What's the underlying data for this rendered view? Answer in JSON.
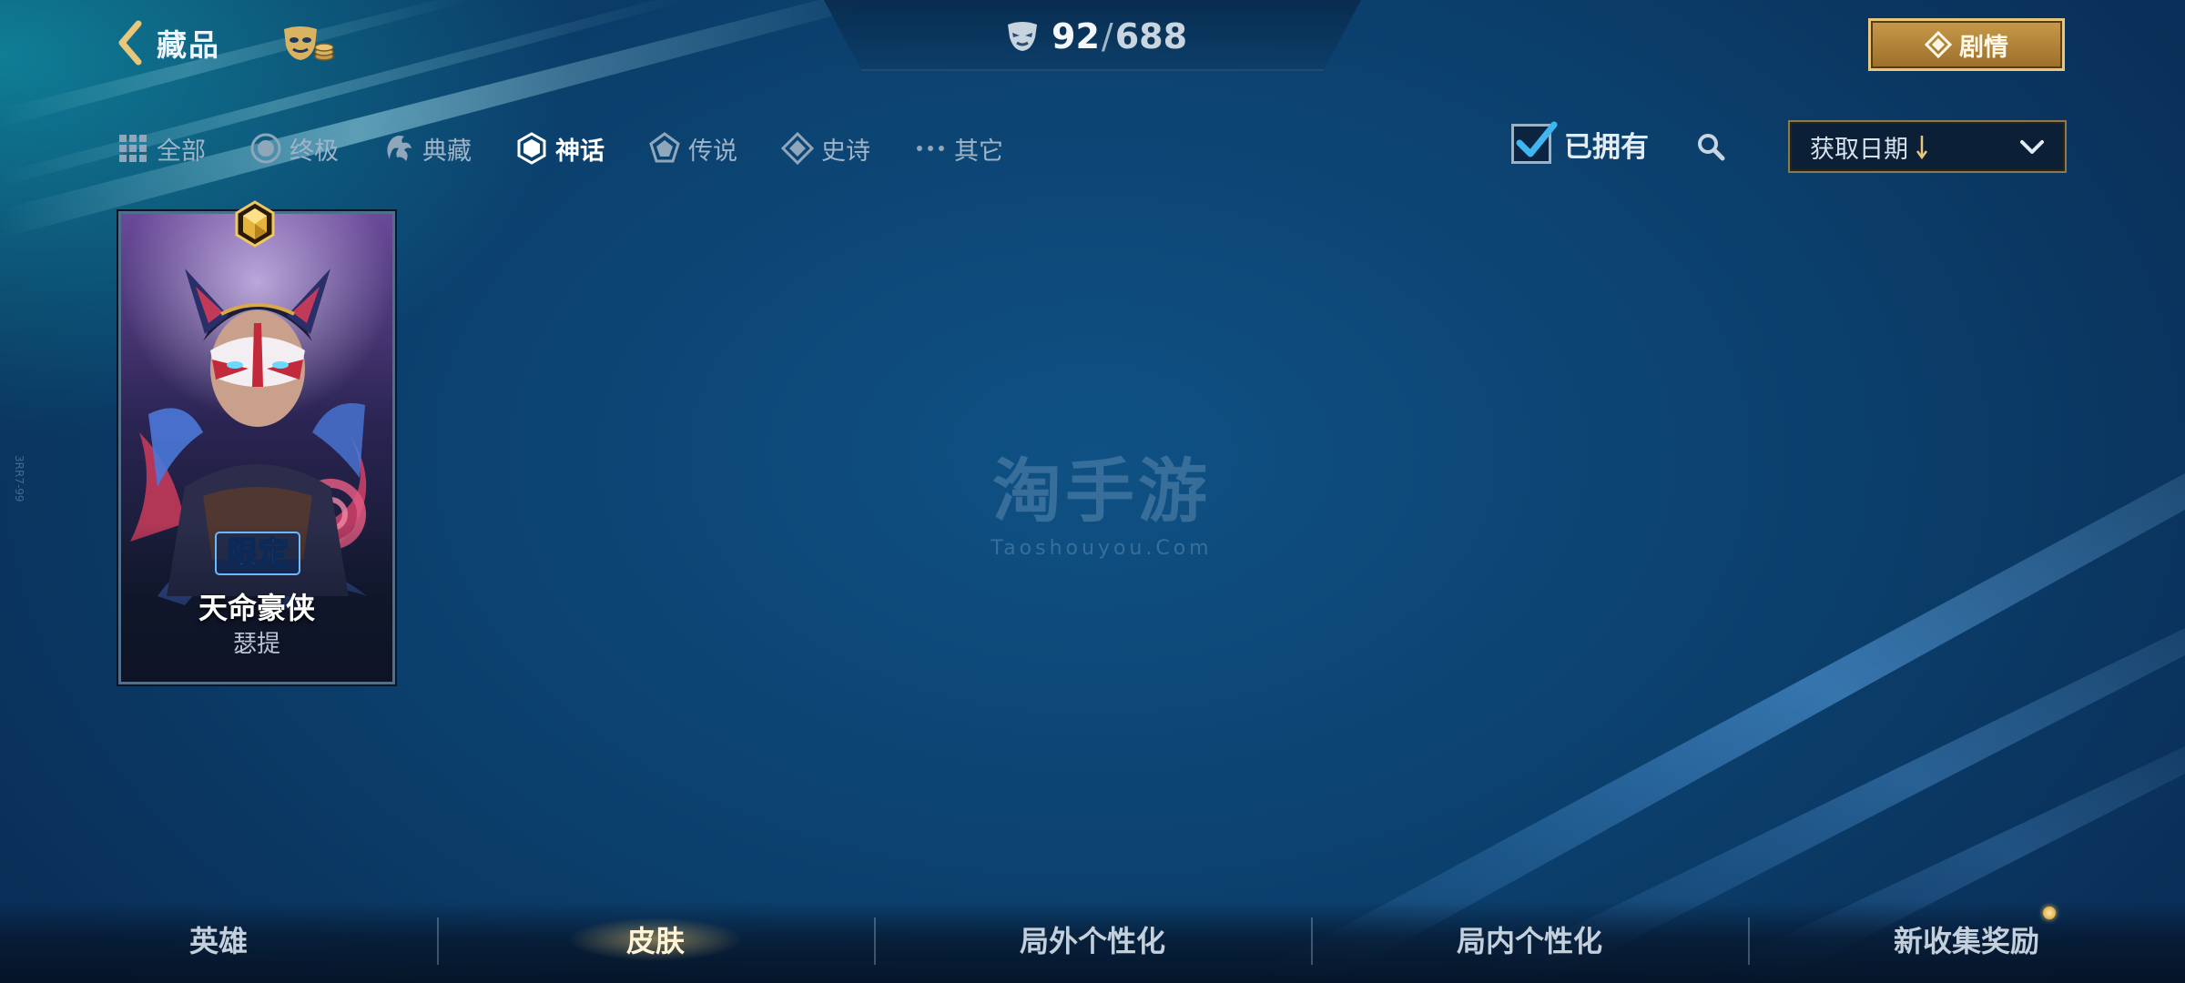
{
  "header": {
    "back_label": "藏品",
    "owned_count": "92",
    "separator": "/",
    "total_count": "688",
    "story_label": "剧情"
  },
  "filters": [
    {
      "label": "全部",
      "icon": "grid-icon"
    },
    {
      "label": "终极",
      "icon": "ultimate-icon"
    },
    {
      "label": "典藏",
      "icon": "dragon-icon"
    },
    {
      "label": "神话",
      "icon": "hexagon-icon",
      "active": true
    },
    {
      "label": "传说",
      "icon": "pentagon-icon"
    },
    {
      "label": "史诗",
      "icon": "diamond-icon"
    },
    {
      "label": "其它",
      "icon": "more-dots-icon"
    }
  ],
  "owned_filter": {
    "label": "已拥有",
    "checked": true
  },
  "sort": {
    "label": "获取日期"
  },
  "skin": {
    "name": "天命豪侠",
    "hero": "瑟提",
    "badge": "限定"
  },
  "watermark": {
    "main": "淘手游",
    "sub": "Taoshouyou.Com"
  },
  "edge_text": "3RR7-99",
  "bottom_tabs": [
    {
      "label": "英雄"
    },
    {
      "label": "皮肤",
      "active": true
    },
    {
      "label": "局外个性化"
    },
    {
      "label": "局内个性化"
    },
    {
      "label": "新收集奖励",
      "has_new": true
    }
  ],
  "colors": {
    "accent_gold": "#e8c67a",
    "check_blue": "#3fb6f0",
    "background": "#0c3f6a"
  }
}
